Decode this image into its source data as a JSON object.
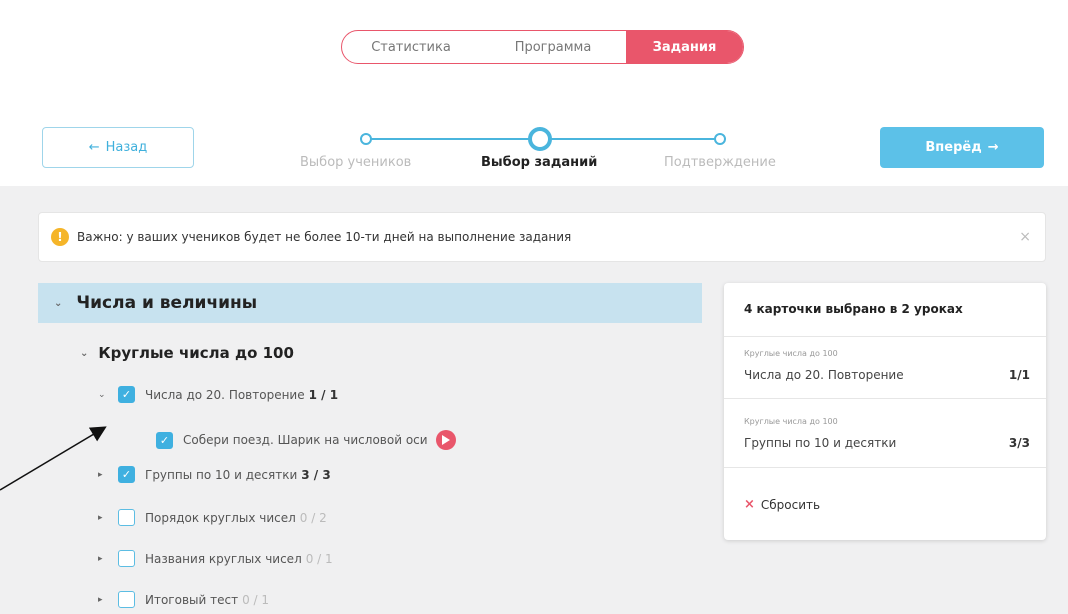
{
  "tabs": [
    {
      "label": "Статистика"
    },
    {
      "label": "Программа"
    },
    {
      "label": "Задания"
    }
  ],
  "nav": {
    "back_label": "Назад",
    "back_arrow": "←",
    "next_label": "Вперёд",
    "next_arrow": "→"
  },
  "stepper": {
    "steps": [
      {
        "label": "Выбор учеников"
      },
      {
        "label": "Выбор заданий"
      },
      {
        "label": "Подтверждение"
      }
    ],
    "active_step": 1
  },
  "alert": {
    "icon": "!",
    "text": "Важно: у ваших учеников будет не более 10-ти дней на выполнение задания",
    "close": "×"
  },
  "section": {
    "title": "Числа и величины",
    "subsection": "Круглые числа до 100",
    "items": [
      {
        "label": "Числа до 20. Повторение",
        "count": "1 / 1",
        "checked": true,
        "expanded": true
      },
      {
        "label": "Собери поезд. Шарик на числовой оси",
        "checked": true,
        "child": true
      },
      {
        "label": "Группы по 10 и десятки",
        "count": "3 / 3",
        "checked": true
      },
      {
        "label": "Порядок круглых чисел",
        "count": "0 / 2",
        "checked": false
      },
      {
        "label": "Названия круглых чисел",
        "count": "0 / 1",
        "checked": false
      },
      {
        "label": "Итоговый тест",
        "count": "0 / 1",
        "checked": false
      }
    ]
  },
  "summary": {
    "title": "4 карточки выбрано в 2 уроках",
    "entries": [
      {
        "category": "Круглые числа до 100",
        "name": "Числа до 20. Повторение",
        "value": "1/1"
      },
      {
        "category": "Круглые числа до 100",
        "name": "Группы по 10 и десятки",
        "value": "3/3"
      }
    ],
    "reset_label": "Сбросить",
    "reset_icon": "×"
  },
  "colors": {
    "accent_red": "#e9566b",
    "accent_blue": "#5cc1e8",
    "section_bg": "#c7e2ef"
  }
}
